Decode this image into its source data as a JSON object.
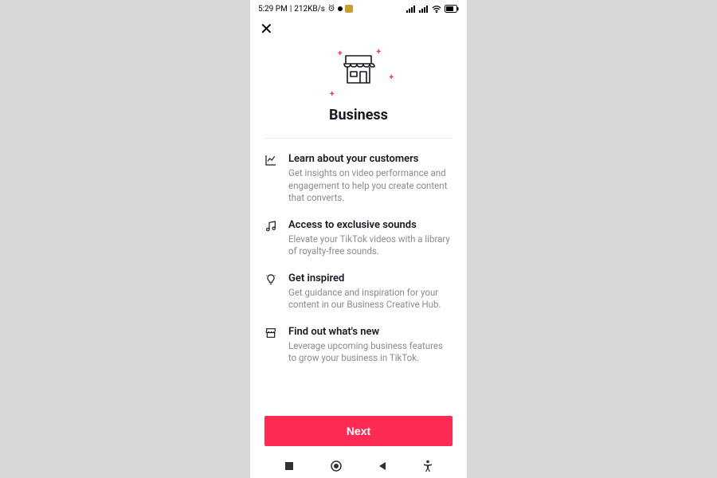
{
  "status_bar": {
    "time": "5:29 PM",
    "network_speed": "212KB/s"
  },
  "hero": {
    "title": "Business"
  },
  "features": [
    {
      "title": "Learn about your customers",
      "desc": "Get insights on video performance and engagement to help you create content that converts."
    },
    {
      "title": "Access to exclusive sounds",
      "desc": "Elevate your TikTok videos with a library of royalty-free sounds."
    },
    {
      "title": "Get inspired",
      "desc": "Get guidance and inspiration for your content in our Business Creative Hub."
    },
    {
      "title": "Find out what's new",
      "desc": "Leverage upcoming business features to grow your business in TikTok."
    }
  ],
  "cta": {
    "label": "Next"
  }
}
